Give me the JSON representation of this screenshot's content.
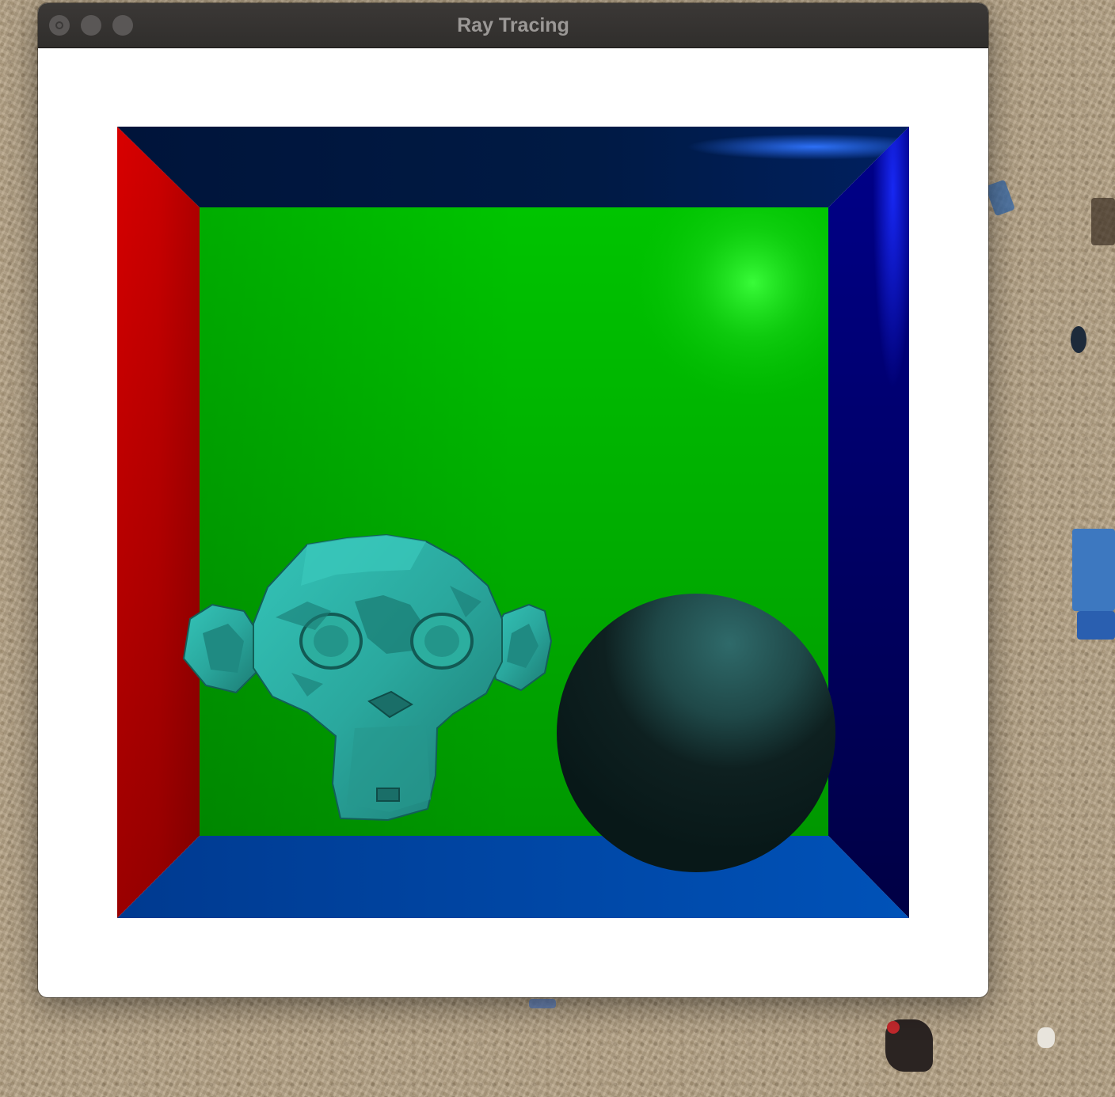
{
  "window": {
    "title": "Ray Tracing"
  },
  "titlebar_buttons": [
    "close",
    "minimize",
    "zoom"
  ],
  "scene": {
    "walls": {
      "left": "#cc0000",
      "right": "#000066",
      "top": "#001a40",
      "bottom": "#0048a8",
      "back": "#00b800"
    },
    "objects": [
      "monkey-head-mesh",
      "dark-teal-sphere"
    ],
    "monkey_color": "#2aa89e",
    "sphere_color": "#0f2a2a"
  }
}
